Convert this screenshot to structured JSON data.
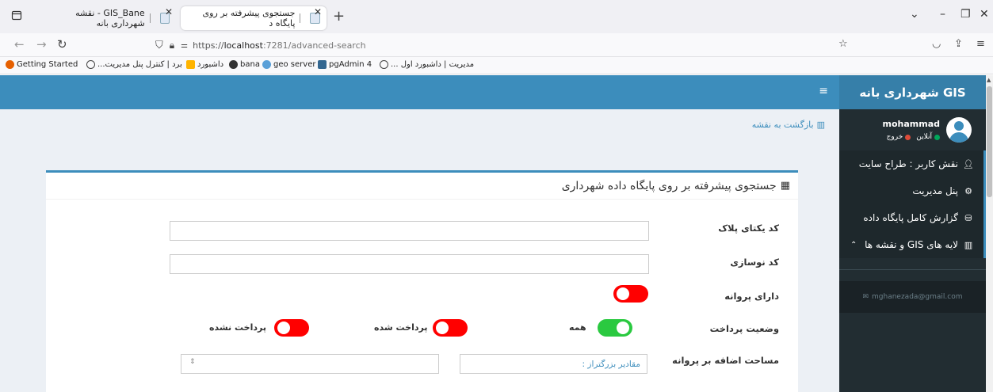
{
  "browser": {
    "tabs": [
      {
        "title": "GIS_Bane - نقشه شهرداری بانه"
      },
      {
        "title": "جستجوی پیشرفته بر روی پایگاه د"
      }
    ],
    "close_glyph": "✕",
    "newtab_glyph": "+",
    "url": {
      "scheme": "https://",
      "host": "localhost",
      "rest": ":7281/advanced-search"
    },
    "bookmarks": [
      {
        "label": "Getting Started"
      },
      {
        "label": "...برد | کنترل پنل مدیریت"
      },
      {
        "label": "داشبورد"
      },
      {
        "label": "bana"
      },
      {
        "label": "geo server"
      },
      {
        "label": "pgAdmin 4"
      },
      {
        "label": "... مدیریت | داشبورد اول"
      }
    ]
  },
  "sidebar": {
    "brand": "GIS شهرداری بانه",
    "user": {
      "name": "mohammad",
      "online": "آنلاین",
      "logout": "خروج"
    },
    "items": [
      {
        "label": "نقش کاربر : طراح سایت",
        "icon": "user-plus-icon"
      },
      {
        "label": "پنل مدیریت",
        "icon": "gears-icon"
      },
      {
        "label": "گزارش کامل پایگاه داده",
        "icon": "database-icon"
      },
      {
        "label": "لایه های GIS و نقشه ها",
        "icon": "map-icon"
      }
    ],
    "email": "mghanezada@gmail.com"
  },
  "main": {
    "back_link": "بازگشت به نقشه",
    "box_title": "جستجوی پیشرفته بر روی پایگاه داده شهرداری",
    "form": {
      "plate_label": "کد یکتای پلاک",
      "renovation_label": "کد نوسازی",
      "license_label": "دارای پروانه",
      "payment_label": "وضعیت پرداخت",
      "payment_all": "همه",
      "payment_paid": "پرداخت شده",
      "payment_unpaid": "پرداخت نشده",
      "area_label": "مساحت اضافه بر پروانه",
      "area_placeholder": "مقادیر بزرگتراز :"
    }
  },
  "colors": {
    "primary": "#3c8dbc",
    "sidebar_bg": "#222d32",
    "toggle_off": "#ff0000",
    "toggle_on": "#2ac940"
  }
}
